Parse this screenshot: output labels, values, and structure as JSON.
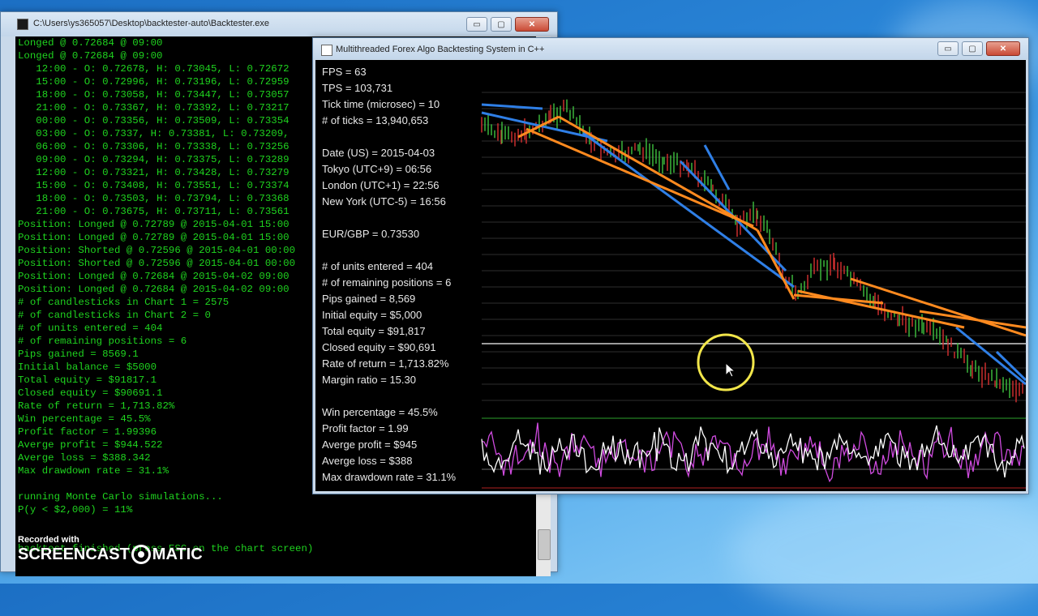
{
  "colors": {
    "console_text": "#1fd41f",
    "chart_text": "#e8e8e8",
    "blue_line": "#2f7fe6",
    "orange_line": "#ff8a1f",
    "osc": "#d04be0",
    "grid": "#9a9a9a"
  },
  "console": {
    "title": "C:\\Users\\ys365057\\Desktop\\backtester-auto\\Backtester.exe",
    "lines": [
      "Longed @ 0.72684 @ 09:00",
      "Longed @ 0.72684 @ 09:00",
      "   12:00 - O: 0.72678, H: 0.73045, L: 0.72672",
      "   15:00 - O: 0.72996, H: 0.73196, L: 0.72959",
      "   18:00 - O: 0.73058, H: 0.73447, L: 0.73057",
      "   21:00 - O: 0.73367, H: 0.73392, L: 0.73217",
      "   00:00 - O: 0.73356, H: 0.73509, L: 0.73354",
      "   03:00 - O: 0.7337, H: 0.73381, L: 0.73209,",
      "   06:00 - O: 0.73306, H: 0.73338, L: 0.73256",
      "   09:00 - O: 0.73294, H: 0.73375, L: 0.73289",
      "   12:00 - O: 0.73321, H: 0.73428, L: 0.73279",
      "   15:00 - O: 0.73408, H: 0.73551, L: 0.73374",
      "   18:00 - O: 0.73503, H: 0.73794, L: 0.73368",
      "   21:00 - O: 0.73675, H: 0.73711, L: 0.73561",
      "Position: Longed @ 0.72789 @ 2015-04-01 15:00",
      "Position: Longed @ 0.72789 @ 2015-04-01 15:00",
      "Position: Shorted @ 0.72596 @ 2015-04-01 00:00",
      "Position: Shorted @ 0.72596 @ 2015-04-01 00:00",
      "Position: Longed @ 0.72684 @ 2015-04-02 09:00",
      "Position: Longed @ 0.72684 @ 2015-04-02 09:00",
      "# of candlesticks in Chart 1 = 2575",
      "# of candlesticks in Chart 2 = 0",
      "# of units entered = 404",
      "# of remaining positions = 6",
      "Pips gained = 8569.1",
      "Initial balance = $5000",
      "Total equity = $91817.1",
      "Closed equity = $90691.1",
      "Rate of return = 1,713.82%",
      "Win percentage = 45.5%",
      "Profit factor = 1.99396",
      "Averge profit = $944.522",
      "Averge loss = $388.342",
      "Max drawdown rate = 31.1%",
      "",
      "running Monte Carlo simulations...",
      "P(y < $2,000) = 11%",
      "",
      "",
      "backtest finished (press ESC on the chart screen)"
    ]
  },
  "chart_window": {
    "title": "Multithreaded Forex Algo Backtesting System in C++",
    "stats": [
      "FPS = 63",
      "TPS = 103,731",
      "Tick time (microsec) = 10",
      "# of ticks = 13,940,653",
      "",
      "Date (US) = 2015-04-03",
      "Tokyo (UTC+9) = 06:56",
      "London (UTC+1) = 22:56",
      "New York (UTC-5) = 16:56",
      "",
      "EUR/GBP = 0.73530",
      "",
      "# of units entered = 404",
      "# of remaining positions = 6",
      "Pips gained = 8,569",
      "Initial equity = $5,000",
      "Total equity = $91,817",
      "Closed equity = $90,691",
      "Rate of return = 1,713.82%",
      "Margin ratio = 15.30",
      "",
      "Win percentage = 45.5%",
      "Profit factor = 1.99",
      "Averge profit = $945",
      "Averge loss = $388",
      "Max drawdown rate = 31.1%"
    ]
  },
  "watermark": {
    "recorded": "Recorded with",
    "brand_left": "SCREENCAST",
    "brand_right": "MATIC"
  },
  "controls": {
    "minimize": "▭",
    "maximize": "▢",
    "close": "✕"
  }
}
